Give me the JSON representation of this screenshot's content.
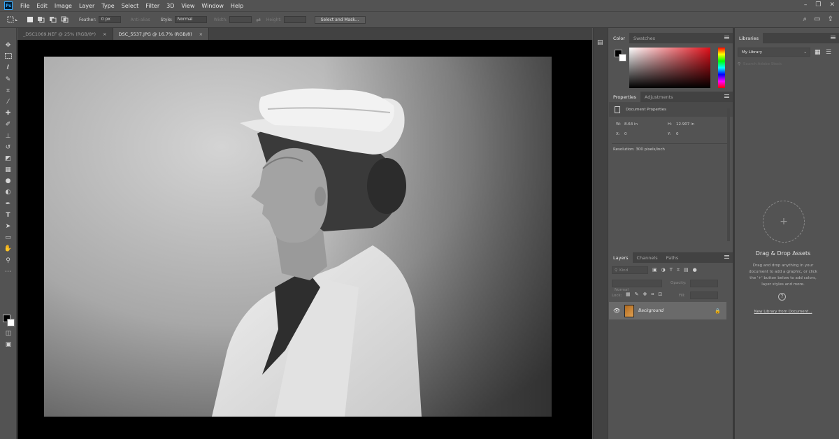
{
  "app": {
    "logo_text": "Ps"
  },
  "menubar": {
    "items": [
      "File",
      "Edit",
      "Image",
      "Layer",
      "Type",
      "Select",
      "Filter",
      "3D",
      "View",
      "Window",
      "Help"
    ]
  },
  "options": {
    "feather_label": "Feather:",
    "feather_value": "0 px",
    "antialias_label": "Anti-alias",
    "style_label": "Style:",
    "style_value": "Normal",
    "width_label": "Width:",
    "height_label": "Height:",
    "select_mask_label": "Select and Mask..."
  },
  "documents": {
    "tabs": [
      {
        "label": "_DSC1069.NEF @ 25% (RGB/8*)",
        "close": "×"
      },
      {
        "label": "DSC_5537.JPG @ 16.7% (RGB/8)",
        "close": "×"
      }
    ]
  },
  "color_panel": {
    "tabs": [
      "Color",
      "Swatches"
    ],
    "foreground": "#000000",
    "background": "#ffffff",
    "hue": "#e0101a"
  },
  "properties_panel": {
    "tabs": [
      "Properties",
      "Adjustments"
    ],
    "title": "Document Properties",
    "w_label": "W:",
    "w_value": "8.64 in",
    "h_label": "H:",
    "h_value": "12.907 in",
    "x_label": "X:",
    "x_value": "0",
    "y_label": "Y:",
    "y_value": "0",
    "resolution": "Resolution: 300 pixels/inch"
  },
  "layers_panel": {
    "tabs": [
      "Layers",
      "Channels",
      "Paths"
    ],
    "kind_placeholder": "Kind",
    "blend_mode": "Normal",
    "opacity_label": "Opacity:",
    "lock_label": "Lock:",
    "fill_label": "Fill:",
    "layer_name": "Background"
  },
  "libraries_panel": {
    "tab": "Libraries",
    "library_name": "My Library",
    "search_placeholder": "Search Adobe Stock",
    "drop_title": "Drag & Drop Assets",
    "drop_text_1": "Drag and drop anything in your",
    "drop_text_2": "document to add a graphic, or click",
    "drop_text_3": "the '+' button below to add colors,",
    "drop_text_4": "layer styles and more.",
    "new_from_doc": "New Library from Document..."
  }
}
